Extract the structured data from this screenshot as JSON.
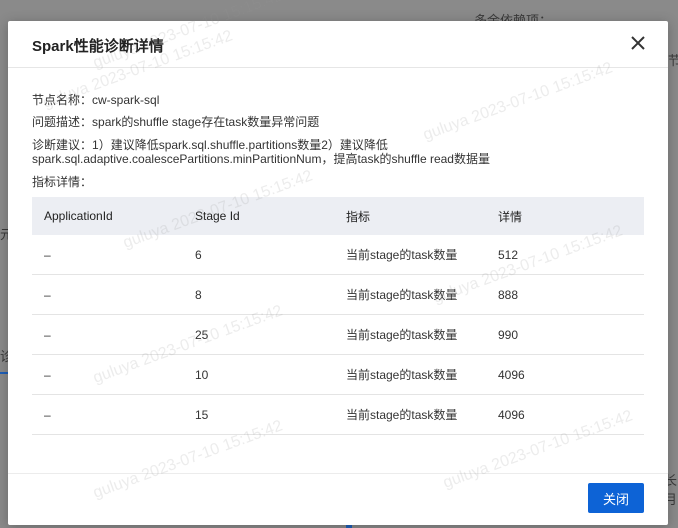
{
  "background": {
    "label_top": "多余依赖项：",
    "label_right": "节",
    "label_left_1": "元",
    "label_left_2": "诊",
    "label_bottom_right": "长月"
  },
  "dialog": {
    "title": "Spark性能诊断详情",
    "node_label": "节点名称：",
    "node_value": "cw-spark-sql",
    "problem_label": "问题描述：",
    "problem_value": "spark的shuffle stage存在task数量异常问题",
    "advice_label": "诊断建议：",
    "advice_line1": "1）建议降低spark.sql.shuffle.partitions数量2）建议降低",
    "advice_line2": "spark.sql.adaptive.coalescePartitions.minPartitionNum，提高task的shuffle read数据量",
    "metrics_label": "指标详情：",
    "close_button": "关闭"
  },
  "table": {
    "headers": [
      "ApplicationId",
      "Stage Id",
      "指标",
      "详情"
    ],
    "rows": [
      [
        "–",
        "6",
        "当前stage的task数量",
        "512"
      ],
      [
        "–",
        "8",
        "当前stage的task数量",
        "888"
      ],
      [
        "–",
        "25",
        "当前stage的task数量",
        "990"
      ],
      [
        "–",
        "10",
        "当前stage的task数量",
        "4096"
      ],
      [
        "–",
        "15",
        "当前stage的task数量",
        "4096"
      ]
    ]
  },
  "watermark": "guluya 2023-07-10 15:15:42",
  "colors": {
    "primary": "#0d63d6",
    "header_bg": "#eceef3"
  }
}
